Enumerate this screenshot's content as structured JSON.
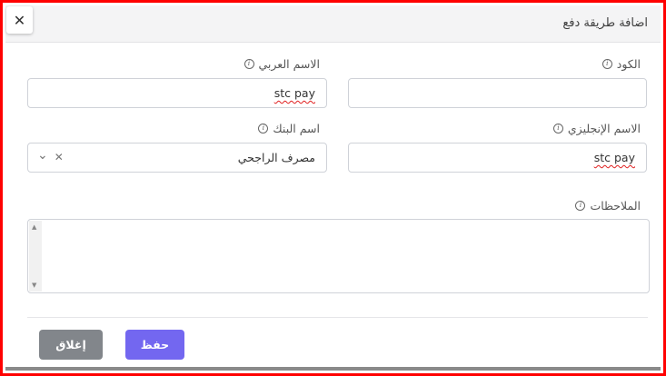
{
  "modal": {
    "title": "اضافة طريقة دفع",
    "close_icon": "close-icon"
  },
  "fields": {
    "code_label": "الكود",
    "code_value": "",
    "arabic_name_label": "الاسم العربي",
    "arabic_name_value": "stc pay",
    "english_name_label": "الاسم الإنجليزي",
    "english_name_value": "stc pay",
    "bank_name_label": "اسم البنك",
    "bank_name_value": "مصرف الراجحي",
    "notes_label": "الملاحظات",
    "notes_value": ""
  },
  "icons": {
    "info": "i",
    "clear": "✕",
    "chevron": "⌄"
  },
  "buttons": {
    "save_label": "حفظ",
    "close_label": "إغلاق"
  },
  "colors": {
    "accent": "#7367f0",
    "secondary": "#82868b",
    "border": "#ff0000"
  }
}
